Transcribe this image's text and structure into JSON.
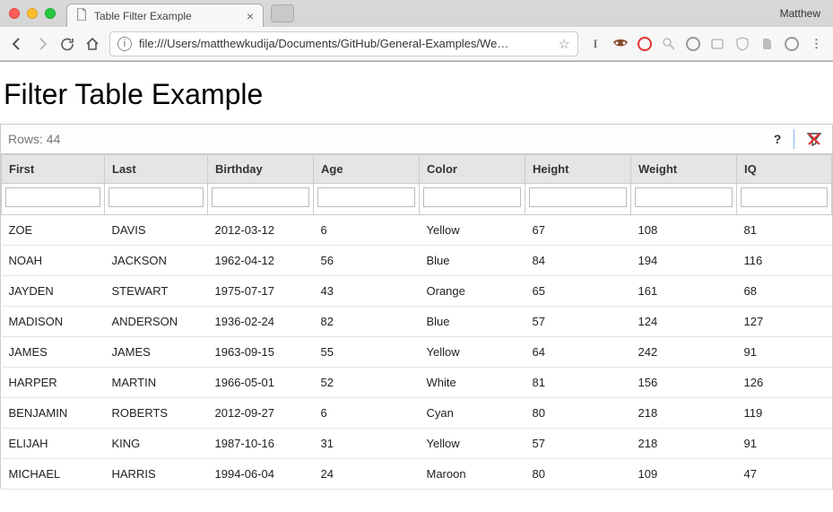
{
  "browser": {
    "profile_name": "Matthew",
    "tab_title": "Table Filter Example",
    "url": "file:///Users/matthewkudija/Documents/GitHub/General-Examples/We…"
  },
  "page": {
    "heading": "Filter Table Example",
    "rows_label": "Rows:",
    "rows_count": "44",
    "help_icon_label": "?",
    "columns": [
      {
        "key": "first",
        "label": "First"
      },
      {
        "key": "last",
        "label": "Last"
      },
      {
        "key": "birthday",
        "label": "Birthday"
      },
      {
        "key": "age",
        "label": "Age"
      },
      {
        "key": "color",
        "label": "Color"
      },
      {
        "key": "height",
        "label": "Height"
      },
      {
        "key": "weight",
        "label": "Weight"
      },
      {
        "key": "iq",
        "label": "IQ"
      }
    ],
    "filters": {
      "first": "",
      "last": "",
      "birthday": "",
      "age": "",
      "color": "",
      "height": "",
      "weight": "",
      "iq": ""
    },
    "rows": [
      {
        "first": "ZOE",
        "last": "DAVIS",
        "birthday": "2012-03-12",
        "age": "6",
        "color": "Yellow",
        "height": "67",
        "weight": "108",
        "iq": "81"
      },
      {
        "first": "NOAH",
        "last": "JACKSON",
        "birthday": "1962-04-12",
        "age": "56",
        "color": "Blue",
        "height": "84",
        "weight": "194",
        "iq": "116"
      },
      {
        "first": "JAYDEN",
        "last": "STEWART",
        "birthday": "1975-07-17",
        "age": "43",
        "color": "Orange",
        "height": "65",
        "weight": "161",
        "iq": "68"
      },
      {
        "first": "MADISON",
        "last": "ANDERSON",
        "birthday": "1936-02-24",
        "age": "82",
        "color": "Blue",
        "height": "57",
        "weight": "124",
        "iq": "127"
      },
      {
        "first": "JAMES",
        "last": "JAMES",
        "birthday": "1963-09-15",
        "age": "55",
        "color": "Yellow",
        "height": "64",
        "weight": "242",
        "iq": "91"
      },
      {
        "first": "HARPER",
        "last": "MARTIN",
        "birthday": "1966-05-01",
        "age": "52",
        "color": "White",
        "height": "81",
        "weight": "156",
        "iq": "126"
      },
      {
        "first": "BENJAMIN",
        "last": "ROBERTS",
        "birthday": "2012-09-27",
        "age": "6",
        "color": "Cyan",
        "height": "80",
        "weight": "218",
        "iq": "119"
      },
      {
        "first": "ELIJAH",
        "last": "KING",
        "birthday": "1987-10-16",
        "age": "31",
        "color": "Yellow",
        "height": "57",
        "weight": "218",
        "iq": "91"
      },
      {
        "first": "MICHAEL",
        "last": "HARRIS",
        "birthday": "1994-06-04",
        "age": "24",
        "color": "Maroon",
        "height": "80",
        "weight": "109",
        "iq": "47"
      }
    ]
  }
}
